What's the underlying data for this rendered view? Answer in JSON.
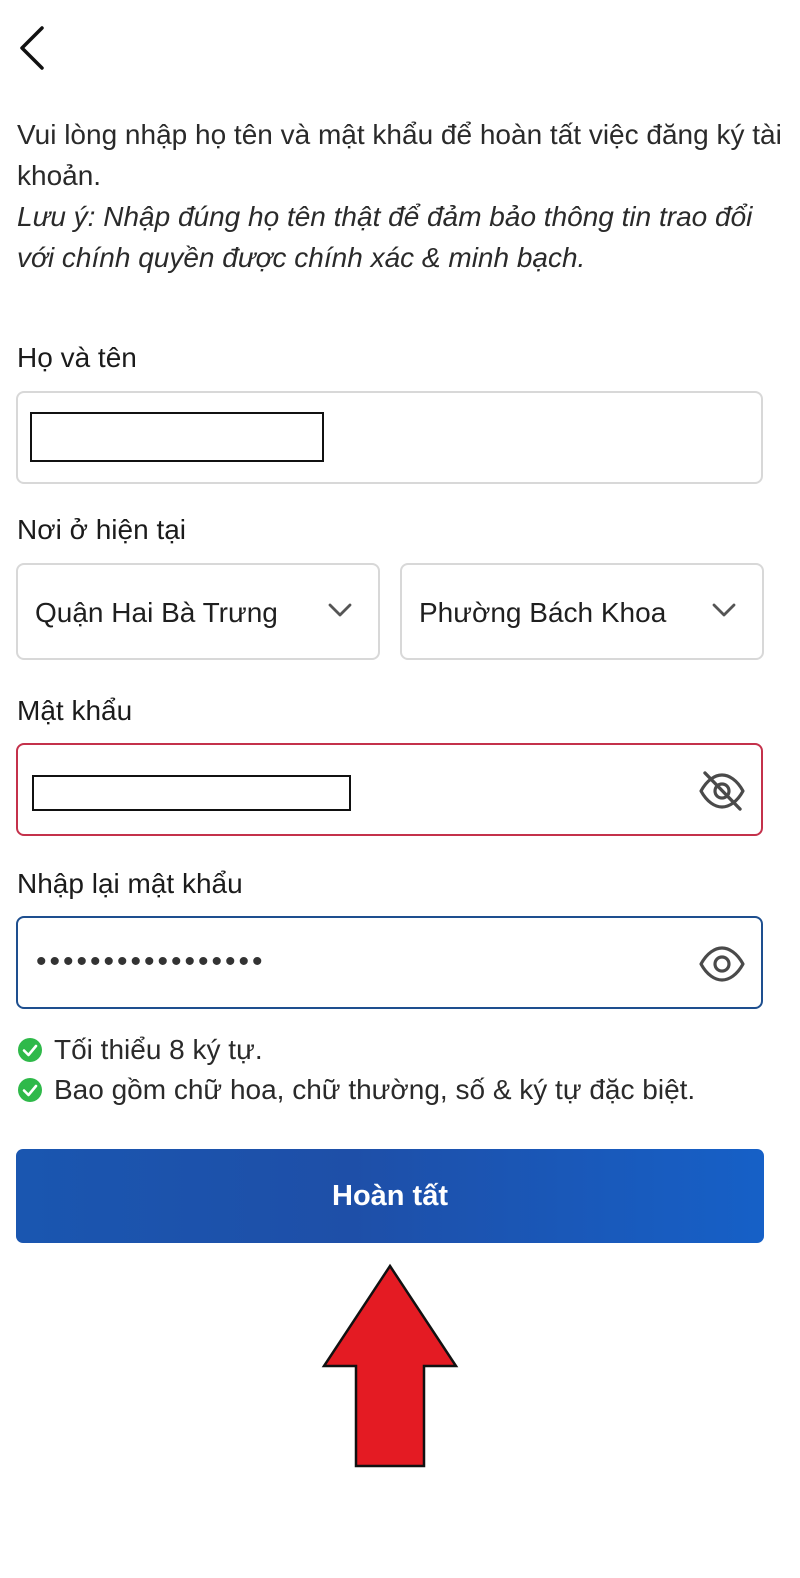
{
  "header": {
    "back_icon": "chevron-left-icon"
  },
  "intro": {
    "text": "Vui lòng nhập họ tên và mật khẩu để hoàn tất việc đăng ký tài khoản.",
    "note": "Lưu ý: Nhập đúng họ tên thật để đảm bảo thông tin trao đổi với chính quyền được chính xác & minh bạch."
  },
  "fullname": {
    "label": "Họ và tên",
    "value": "[redacted]"
  },
  "residence": {
    "label": "Nơi ở hiện tại",
    "district": "Quận Hai Bà Trưng",
    "ward": "Phường Bách Khoa",
    "dropdown_icon": "chevron-down-icon"
  },
  "password": {
    "label": "Mật khẩu",
    "value": "[redacted]",
    "toggle_icon": "eye-slash-icon",
    "state": "error"
  },
  "confirm_password": {
    "label": "Nhập lại mật khẩu",
    "masked_value": "•••••••••••••••••",
    "toggle_icon": "eye-icon",
    "state": "focused"
  },
  "rules": [
    {
      "text": "Tối thiểu 8 ký tự.",
      "icon": "check-circle-icon"
    },
    {
      "text": "Bao gồm chữ hoa, chữ thường, số & ký tự đặc biệt.",
      "icon": "check-circle-icon"
    }
  ],
  "submit": {
    "label": "Hoàn tất"
  },
  "colors": {
    "primary": "#1a56b0",
    "error_border": "#c4314b",
    "focus_border": "#1e4f8f",
    "check": "#2fb94a",
    "annotation_arrow": "#e41b23"
  }
}
